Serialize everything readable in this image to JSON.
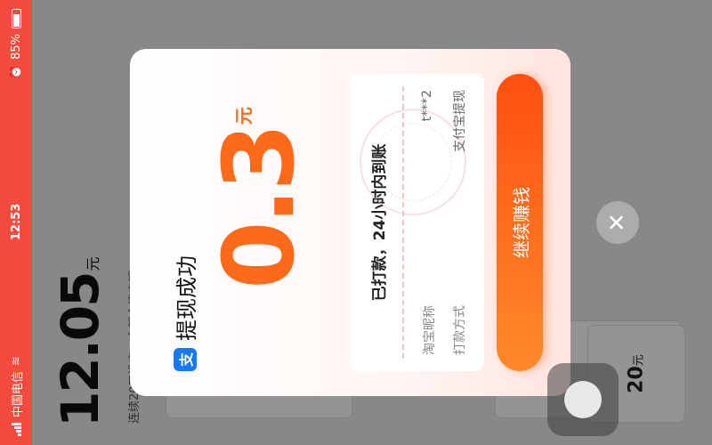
{
  "status": {
    "carrier": "中国电信",
    "time": "12:53",
    "battery": "85%"
  },
  "background": {
    "balance": "12.05",
    "balance_unit": "元",
    "subtitle": "连续20天没来，余额会清空哦",
    "card_amount": "20",
    "card_unit": "元"
  },
  "modal": {
    "title": "提现成功",
    "amount": "0.3",
    "unit": "元",
    "receipt_title": "已打款，24小时内到账",
    "nickname_label": "淘宝昵称",
    "nickname_value": "t***2",
    "method_label": "打款方式",
    "method_value": "支付宝提现",
    "cta": "继续赚钱"
  },
  "colors": {
    "accent": "#ff6a1a",
    "status_bar": "#f54b3c",
    "alipay": "#1677ff"
  },
  "icons": {
    "close": "close-icon",
    "alipay": "alipay-icon",
    "wifi": "wifi-icon",
    "battery": "battery-icon",
    "alarm": "alarm-icon"
  }
}
